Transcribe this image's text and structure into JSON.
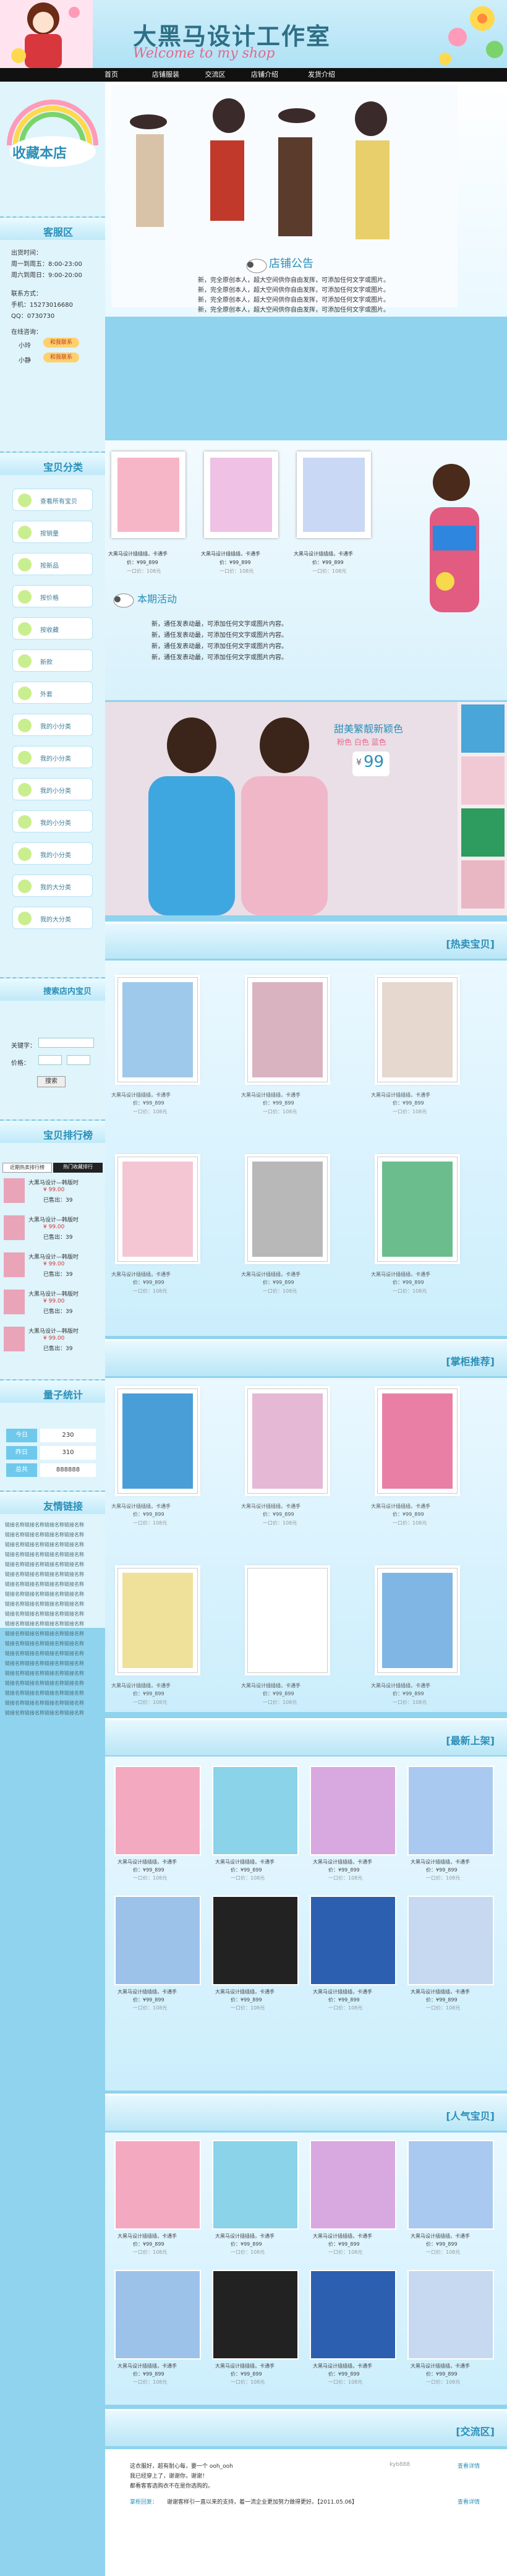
{
  "header": {
    "title": "大黑马设计工作室",
    "subtitle": "Welcome to my shop"
  },
  "nav": [
    "首页",
    "店铺服装",
    "交流区",
    "店铺介绍",
    "发货介绍"
  ],
  "sidebar": {
    "collect": "收藏本店",
    "service_title": "客服区",
    "hours_label": "出货时间：",
    "hours_1": "周一到周五：8:00-23:00",
    "hours_2": "周六到周日：9:00-20:00",
    "contact_label": "联系方式：",
    "phone": "手机：15273016680",
    "qq": "QQ：0730730",
    "ww_label": "在线咨询：",
    "ww_1": "小玲",
    "ww_2": "小静",
    "ww_btn": "和我联系",
    "cat_title": "宝贝分类",
    "categories": [
      "查看所有宝贝",
      "按销量",
      "按新品",
      "按价格",
      "按收藏",
      "新款",
      "外套",
      "我的小分类",
      "我的小分类",
      "我的小分类",
      "我的小分类",
      "我的小分类",
      "我的大分类",
      "我的大分类"
    ],
    "search_title": "搜索店内宝贝",
    "kw_label": "关键字：",
    "price_label": "价格：",
    "search_btn": "搜索",
    "rank_title": "宝贝排行榜",
    "rank_tabs": [
      "近期热卖排行榜",
      "热门收藏排行"
    ],
    "rank_items": [
      {
        "name": "大黑马设计—韩版时",
        "price": "¥ 99.00",
        "sold": "已售出：39"
      },
      {
        "name": "大黑马设计—韩版时",
        "price": "¥ 99.00",
        "sold": "已售出：39"
      },
      {
        "name": "大黑马设计—韩版时",
        "price": "¥ 99.00",
        "sold": "已售出：39"
      },
      {
        "name": "大黑马设计—韩版时",
        "price": "¥ 99.00",
        "sold": "已售出：39"
      },
      {
        "name": "大黑马设计—韩版时",
        "price": "¥ 99.00",
        "sold": "已售出：39"
      }
    ],
    "stats_title": "量子统计",
    "stats": [
      {
        "label": "今日",
        "value": "230"
      },
      {
        "label": "昨日",
        "value": "310"
      },
      {
        "label": "总共",
        "value": "888888"
      }
    ],
    "links_title": "友情链接",
    "link_text": "链接名称链接名称链接名称链接名称"
  },
  "notice": {
    "title": "店铺公告",
    "lines": [
      "新，完全原创本人，超大空间供你自由发挥，可添加任何文字或图片。",
      "新，完全原创本人，超大空间供你自由发挥，可添加任何文字或图片。",
      "新，完全原创本人，超大空间供你自由发挥，可添加任何文字或图片。",
      "新，完全原创本人，超大空间供你自由发挥，可添加任何文字或图片。"
    ]
  },
  "promo_cards": [
    {
      "name": "大黑马设计插插插，卡通手",
      "price": "价：¥99_899",
      "deal": "一口价：108元"
    },
    {
      "name": "大黑马设计插插插，卡通手",
      "price": "价：¥99_899",
      "deal": "一口价：108元"
    },
    {
      "name": "大黑马设计插插插，卡通手",
      "price": "价：¥99_899",
      "deal": "一口价：108元"
    }
  ],
  "activity": {
    "title": "本期活动",
    "lines": [
      "新，通任发表动最，可添加任何文字或图片内容。",
      "新，通任发表动最，可添加任何文字或图片内容。",
      "新，通任发表动最，可添加任何文字或图片内容。",
      "新，通任发表动最，可添加任何文字或图片内容。"
    ]
  },
  "banner2": {
    "headline": "甜美繁靓新颖色",
    "sub": "粉色 白色 蓝色",
    "price": "99",
    "currency": "¥"
  },
  "hot": {
    "title": "[热卖宝贝]",
    "items": [
      {
        "name": "大黑马设计插插插，卡通手",
        "price": "价：¥99_899",
        "deal": "一口价：108元"
      },
      {
        "name": "大黑马设计插插插，卡通手",
        "price": "价：¥99_899",
        "deal": "一口价：108元"
      },
      {
        "name": "大黑马设计插插插，卡通手",
        "price": "价：¥99_899",
        "deal": "一口价：108元"
      },
      {
        "name": "大黑马设计插插插，卡通手",
        "price": "价：¥99_899",
        "deal": "一口价：108元"
      },
      {
        "name": "大黑马设计插插插，卡通手",
        "price": "价：¥99_899",
        "deal": "一口价：108元"
      },
      {
        "name": "大黑马设计插插插，卡通手",
        "price": "价：¥99_899",
        "deal": "一口价：108元"
      }
    ]
  },
  "recommend": {
    "title": "[掌柜推荐]",
    "items": [
      {
        "name": "大黑马设计插插插，卡通手",
        "price": "价：¥99_899",
        "deal": "一口价：108元"
      },
      {
        "name": "大黑马设计插插插，卡通手",
        "price": "价：¥99_899",
        "deal": "一口价：108元"
      },
      {
        "name": "大黑马设计插插插，卡通手",
        "price": "价：¥99_899",
        "deal": "一口价：108元"
      },
      {
        "name": "大黑马设计插插插，卡通手",
        "price": "价：¥99_899",
        "deal": "一口价：108元"
      },
      {
        "name": "大黑马设计插插插，卡通手",
        "price": "价：¥99_899",
        "deal": "一口价：108元"
      },
      {
        "name": "大黑马设计插插插，卡通手",
        "price": "价：¥99_899",
        "deal": "一口价：108元"
      }
    ]
  },
  "newest": {
    "title": "[最新上架]",
    "item_name": "大黑马设计插插插，卡通手",
    "item_price": "价：¥99_899",
    "item_deal": "一口价：108元"
  },
  "popular": {
    "title": "[人气宝贝]",
    "item_name": "大黑马设计插插插，卡通手",
    "item_price": "价：¥99_899",
    "item_deal": "一口价：108元"
  },
  "exchange": {
    "title": "[交流区]",
    "lines": [
      "这衣服好，超有耐心每，要一个 ooh_ooh",
      "我已经穿上了，谢谢你，谢谢！",
      "都看客客选购衣不在是你选购的。"
    ],
    "reply_label": "掌柜回复：",
    "reply_text": "谢谢客样引一直以来的支持，着一流企业更加努力做得更好。【2011.05.06】",
    "user": "kyb888",
    "view_label": "查看详情"
  },
  "colors": {
    "bg": "#8fd3ee",
    "accent": "#2b8fb8",
    "pink": "#e3688c"
  }
}
